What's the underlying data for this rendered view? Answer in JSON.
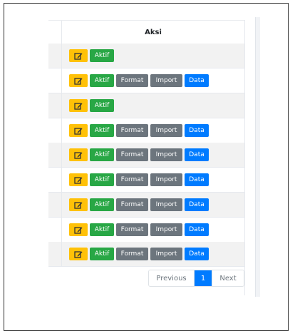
{
  "table": {
    "column_header": "Aksi",
    "rows": [
      {
        "buttons": [
          "edit",
          "Aktif"
        ]
      },
      {
        "buttons": [
          "edit",
          "Aktif",
          "Format",
          "Import",
          "Data"
        ]
      },
      {
        "buttons": [
          "edit",
          "Aktif"
        ]
      },
      {
        "buttons": [
          "edit",
          "Aktif",
          "Format",
          "Import",
          "Data"
        ]
      },
      {
        "buttons": [
          "edit",
          "Aktif",
          "Format",
          "Import",
          "Data"
        ]
      },
      {
        "buttons": [
          "edit",
          "Aktif",
          "Format",
          "Import",
          "Data"
        ]
      },
      {
        "buttons": [
          "edit",
          "Aktif",
          "Format",
          "Import",
          "Data"
        ]
      },
      {
        "buttons": [
          "edit",
          "Aktif",
          "Format",
          "Import",
          "Data"
        ]
      },
      {
        "buttons": [
          "edit",
          "Aktif",
          "Format",
          "Import",
          "Data"
        ]
      }
    ],
    "labels": {
      "aktif": "Aktif",
      "format": "Format",
      "import": "Import",
      "data": "Data"
    }
  },
  "pagination": {
    "previous": "Previous",
    "current": "1",
    "next": "Next"
  },
  "colors": {
    "edit": "#ffc107",
    "aktif": "#28a745",
    "secondary": "#6c757d",
    "primary": "#007bff"
  },
  "icons": {
    "edit": "edit-icon"
  }
}
